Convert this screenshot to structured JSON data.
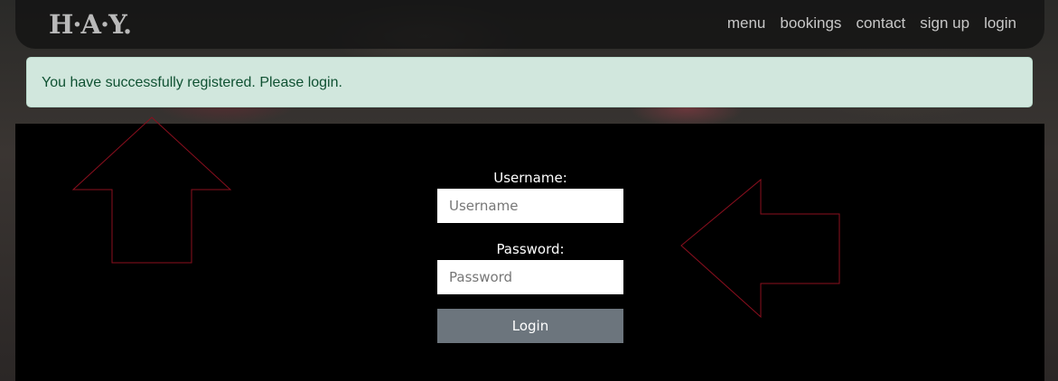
{
  "nav": {
    "brand": "H·A·Y.",
    "links": [
      "menu",
      "bookings",
      "contact",
      "sign up",
      "login"
    ]
  },
  "alert": {
    "message": "You have successfully registered. Please login."
  },
  "form": {
    "username_label": "Username:",
    "username_placeholder": "Username",
    "username_value": "",
    "password_label": "Password:",
    "password_placeholder": "Password",
    "password_value": "",
    "submit_label": "Login"
  },
  "colors": {
    "alert_bg": "#d1e7dd",
    "alert_text": "#0f5132",
    "button_bg": "#6c757d",
    "arrow_stroke": "#8b0f1e"
  }
}
